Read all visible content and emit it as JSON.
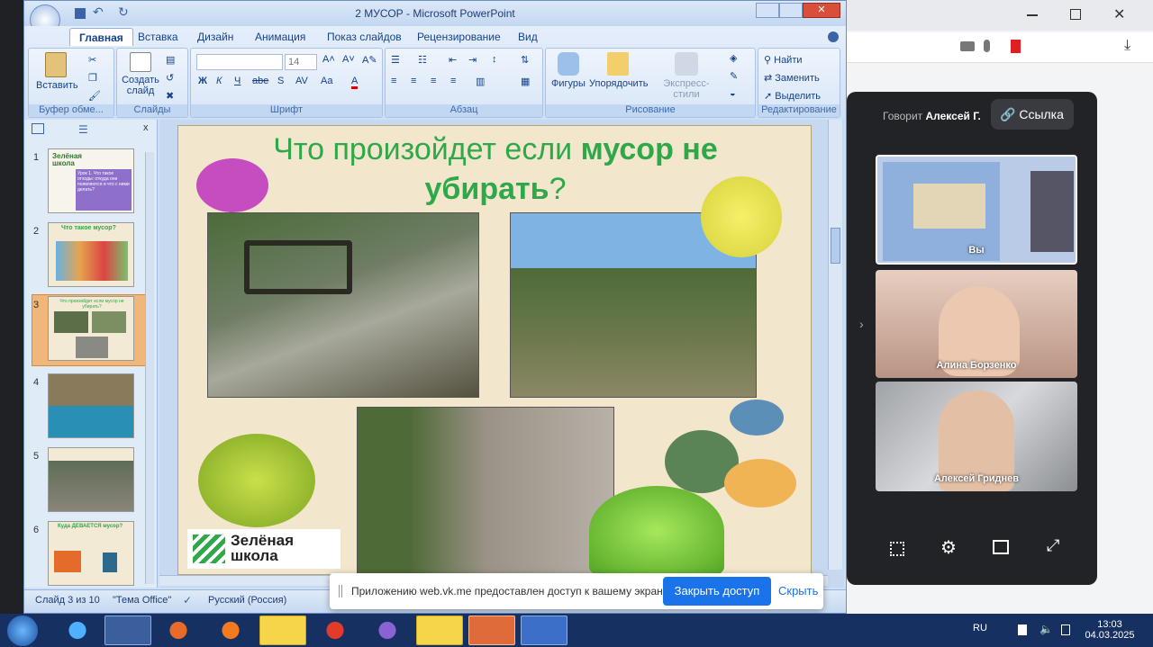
{
  "ppt": {
    "title": "2 МУСОР - Microsoft PowerPoint",
    "tabs": [
      "Главная",
      "Вставка",
      "Дизайн",
      "Анимация",
      "Показ слайдов",
      "Рецензирование",
      "Вид"
    ],
    "groups": {
      "clipboard": "Буфер обме...",
      "slides": "Слайды",
      "font": "Шрифт",
      "paragraph": "Абзац",
      "drawing": "Рисование",
      "editing": "Редактирование"
    },
    "buttons": {
      "paste": "Вставить",
      "create_slide": "Создать слайд",
      "shapes": "Фигуры",
      "arrange": "Упорядочить",
      "quick_styles": "Экспресс-стили",
      "find": "Найти",
      "replace": "Заменить",
      "select": "Выделить"
    },
    "font_size": "14",
    "font_format": [
      "Ж",
      "К",
      "Ч",
      "abe",
      "S",
      "AV",
      "Aa",
      "A"
    ],
    "slide_numbers": [
      "1",
      "2",
      "3",
      "4",
      "5",
      "6"
    ],
    "thumb_texts": {
      "t1_brand": "Зелёная школа",
      "t1_text": "Урок 1. Что такое отходы: откуда они появляются и что с ними делать?",
      "t2_title": "Что такое мусор?",
      "t3_title": "Что произойдет если мусор не убирать?",
      "t6_title": "Куда ДЕВАЕТСЯ мусор?"
    },
    "slide": {
      "title_normal": "Что произойдет если ",
      "title_bold": "мусор не убирать",
      "title_end": "?",
      "logo_line1": "Зелёная",
      "logo_line2": "школа"
    },
    "status": {
      "slide_of": "Слайд 3 из 10",
      "theme": "\"Тема Office\"",
      "language": "Русский (Россия)"
    }
  },
  "vk": {
    "speaking_label": "Говорит",
    "speaking_name": "Алексей Г.",
    "link_button": "Ссылка",
    "participants": [
      "Вы",
      "Алина Борзенко",
      "Алексей Гриднев"
    ]
  },
  "share_bar": {
    "message": "Приложению web.vk.me предоставлен доступ к вашему экрану.",
    "stop_button": "Закрыть доступ",
    "hide_button": "Скрыть"
  },
  "taskbar": {
    "lang": "RU",
    "time": "13:03",
    "date": "04.03.2025"
  },
  "colors": {
    "green_title": "#2fa84a",
    "share_blue": "#1a73e8",
    "taskbar": "#163062"
  }
}
